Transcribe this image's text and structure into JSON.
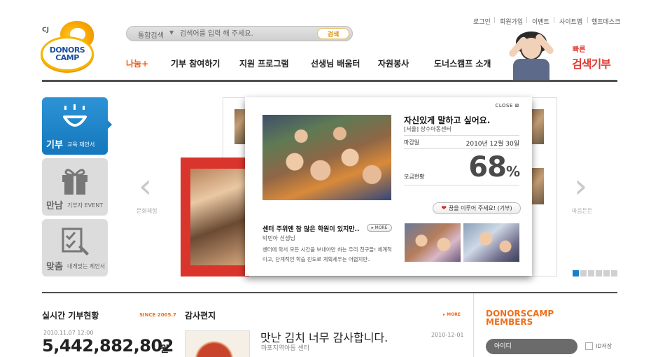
{
  "header": {
    "logo": {
      "cj_mark": "CJ",
      "line1": "DONORS",
      "line2": "CAMP"
    },
    "search": {
      "category": "통합검색",
      "placeholder": "검색어를 입력 해 주세요.",
      "button": "검색"
    },
    "util_links": [
      "로그인",
      "회원가입",
      "이벤트",
      "사이트맵",
      "헬프데스크"
    ],
    "gnb": [
      "나눔+",
      "기부 참여하기",
      "지원 프로그램",
      "선생님 배움터",
      "자원봉사",
      "도너스캠프 소개"
    ],
    "banner": {
      "small": "빠른",
      "big": "검색기부"
    }
  },
  "tabs": [
    {
      "big": "기부",
      "small": "교육 제안서",
      "icon": "smile-icon",
      "active": true
    },
    {
      "big": "만남",
      "small": "기부자 EVENT",
      "icon": "gift-icon",
      "active": false
    },
    {
      "big": "맞춤",
      "small": "내게맞는 제안서",
      "icon": "checklist-pen-icon",
      "active": false
    }
  ],
  "carousel": {
    "prev_caption": "문화체험",
    "next_caption": "마음든든",
    "page_count": 6,
    "active_page": 1
  },
  "popup": {
    "close": "CLOSE",
    "title": "자신있게 말하고 싶어요.",
    "subtitle": "[서울] 상수아동센터",
    "due_label": "마감일",
    "due_value": "2010년 12월 30일",
    "progress_label": "모금현황",
    "progress_value": "68",
    "progress_unit": "%",
    "donate_button": "꿈을 이루어 주세요! (기부)",
    "letter_title": "센터 주위엔 참 많은 학원이 있지만..",
    "more": "MORE",
    "teacher": "박민아 선생님",
    "body": "센터에 와서 모든 시간을 보내야만 하는 우리 친구들! 체계적이고, 단계적인 학습 진도로 계획세우는 어렵지만.."
  },
  "donation_status": {
    "title": "실시간 기부현황",
    "since": "SINCE 2005.7",
    "timestamp": "2010.11.07 12:00",
    "total": "5,442,882,802",
    "unit": "원"
  },
  "letters": {
    "title": "감사편지",
    "more": "MORE",
    "item_title": "맛난 김치 너무 감사합니다.",
    "item_org": "마포지역아동 센터",
    "item_date": "2010-12-01"
  },
  "members": {
    "title_line1": "DONORSCAMP",
    "title_line2": "MEMBERS",
    "id_placeholder": "아이디",
    "remember_label": "ID저장"
  },
  "colors": {
    "accent_orange": "#ef6f1a",
    "tab_blue": "#1577bd",
    "banner_red": "#e23b34",
    "logo_navy": "#1d4f9c"
  }
}
